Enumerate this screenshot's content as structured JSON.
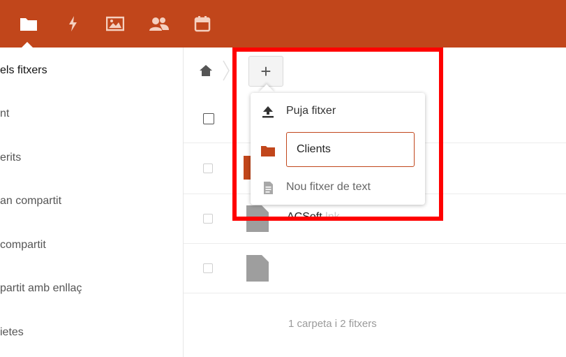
{
  "topbar": {
    "apps": [
      {
        "icon": "folder-icon",
        "name": "files"
      },
      {
        "icon": "lightning-icon",
        "name": "activity"
      },
      {
        "icon": "image-icon",
        "name": "gallery"
      },
      {
        "icon": "contacts-icon",
        "name": "contacts"
      },
      {
        "icon": "calendar-icon",
        "name": "calendar"
      }
    ],
    "colors": {
      "brand": "#c1461b"
    }
  },
  "sidebar": {
    "items": [
      {
        "label": "els fitxers",
        "active": true
      },
      {
        "label": "nt"
      },
      {
        "label": "erits"
      },
      {
        "label": "an compartit"
      },
      {
        "label": "compartit"
      },
      {
        "label": "partit amb enllaç"
      },
      {
        "label": "ietes"
      }
    ]
  },
  "breadcrumb": {
    "home_icon": "home-icon",
    "new_button_label": "+"
  },
  "file_list": {
    "rows": [
      {
        "name": "",
        "ext": "",
        "type": "folder"
      },
      {
        "name": "ACSoft",
        "ext": ".lnk",
        "type": "file"
      },
      {
        "name": "",
        "ext": "",
        "type": "file"
      }
    ],
    "summary": "1 carpeta i 2 fitxers"
  },
  "new_menu": {
    "upload_label": "Puja fitxer",
    "folder_name_value": "Clients",
    "new_text_label": "Nou fitxer de text"
  }
}
